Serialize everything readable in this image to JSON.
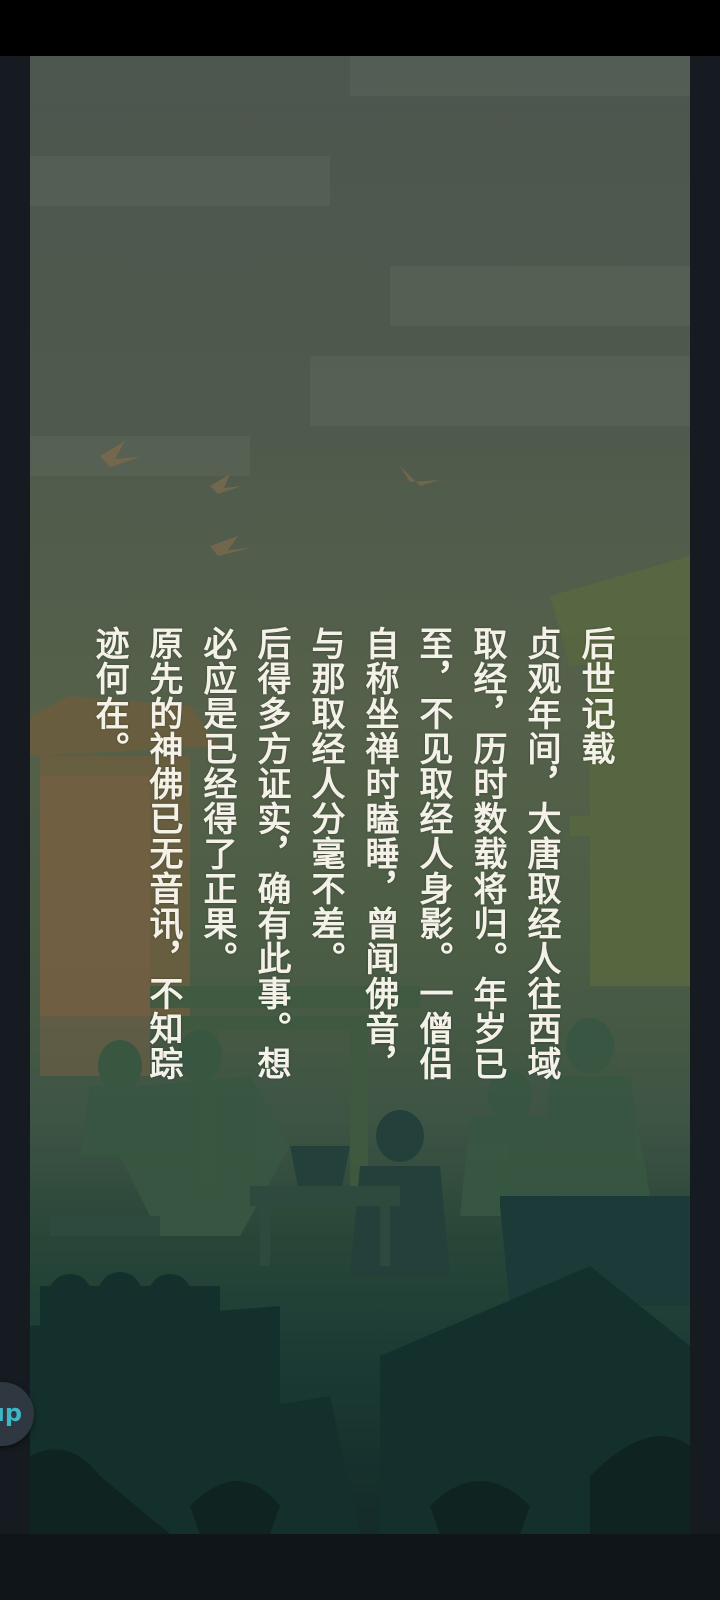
{
  "story": {
    "columns": [
      "后世记载",
      "贞观年间，大唐取经人往西域",
      "取经，历时数载将归。年岁已",
      "至，不见取经人身影。一僧侣",
      "自称坐禅时瞌睡，曾闻佛音，",
      "与那取经人分毫不差。",
      "后得多方证实，确有此事。想",
      "必应是已经得了正果。",
      "原先的神佛已无音讯，不知踪",
      "迹何在。"
    ]
  },
  "floating_button": {
    "label": "ıp",
    "accent_color": "#3fb6c6"
  },
  "colors": {
    "text": "#f3f1e8",
    "panel_top": "#4d564f",
    "panel_bottom": "#132b29",
    "background": "#0c1116"
  }
}
